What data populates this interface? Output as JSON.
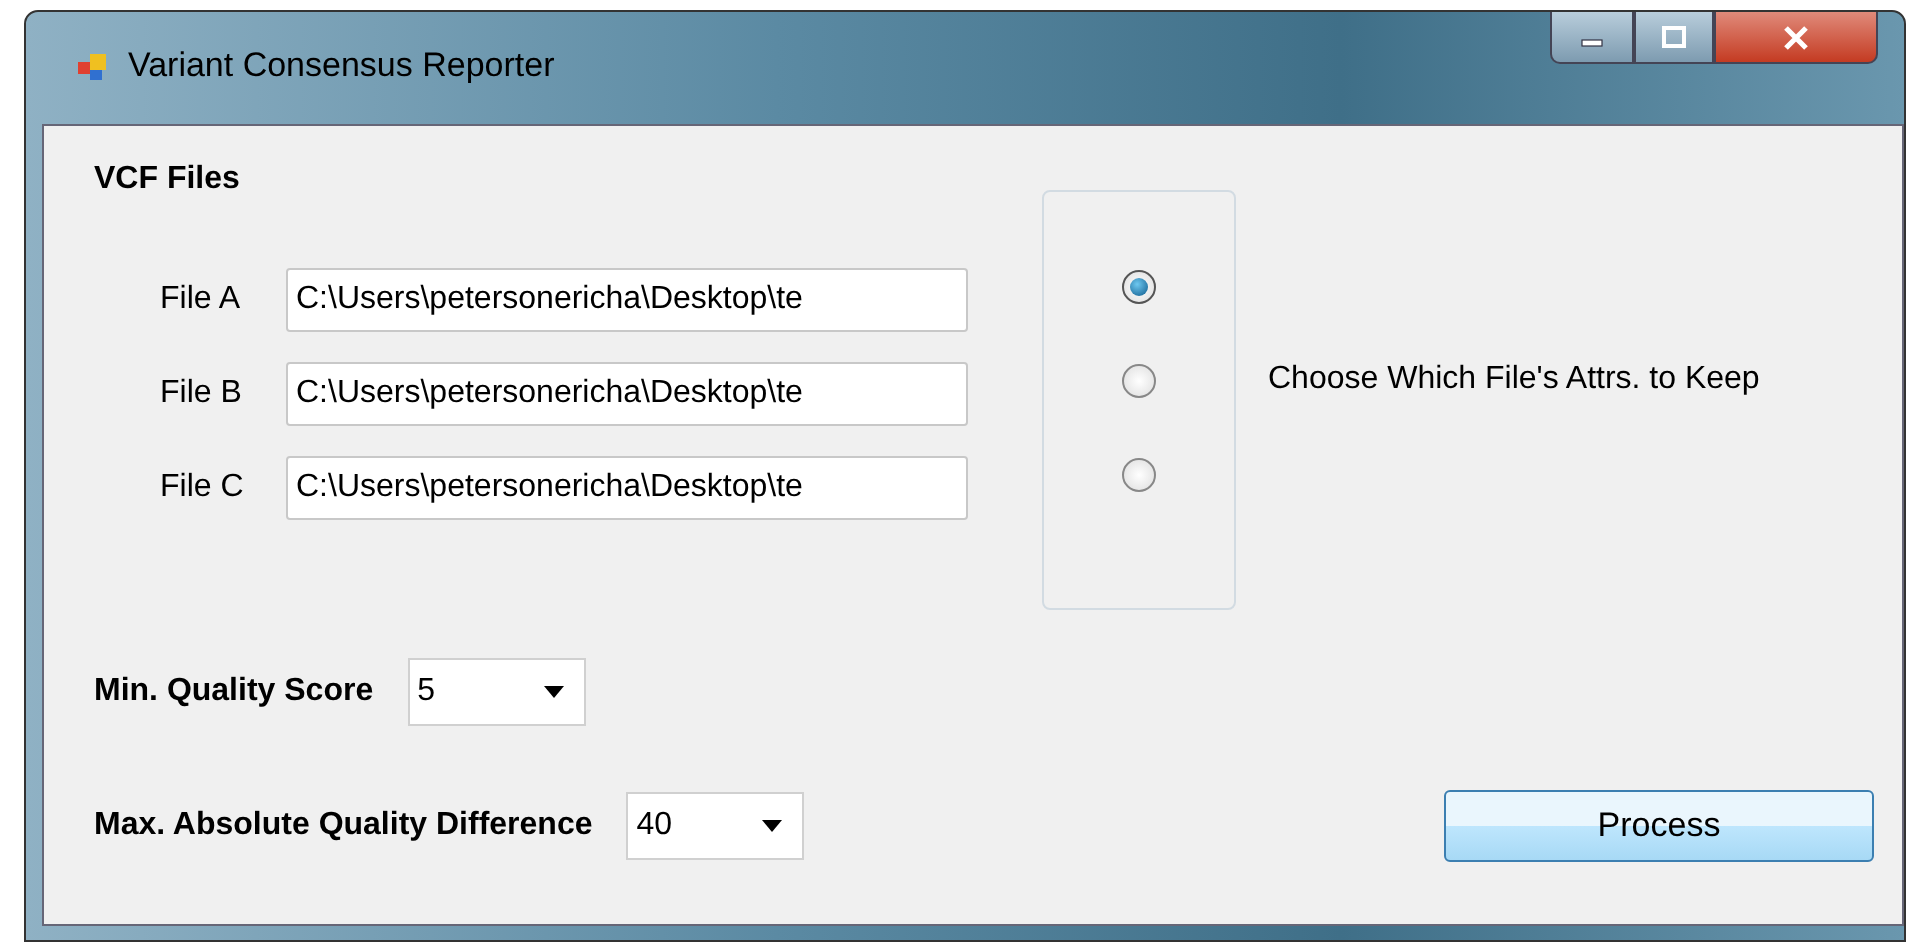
{
  "window": {
    "title": "Variant Consensus Reporter"
  },
  "vcf_files": {
    "heading": "VCF Files",
    "files": [
      {
        "label": "File A",
        "value": "C:\\Users\\petersonericha\\Desktop\\te",
        "selected": true
      },
      {
        "label": "File B",
        "value": "C:\\Users\\petersonericha\\Desktop\\te",
        "selected": false
      },
      {
        "label": "File C",
        "value": "C:\\Users\\petersonericha\\Desktop\\te",
        "selected": false
      }
    ],
    "choice_label": "Choose Which File's Attrs. to Keep"
  },
  "min_quality": {
    "label": "Min. Quality Score",
    "value": "5"
  },
  "max_difference": {
    "label": "Max. Absolute Quality Difference",
    "value": "40"
  },
  "buttons": [
    "Process"
  ]
}
